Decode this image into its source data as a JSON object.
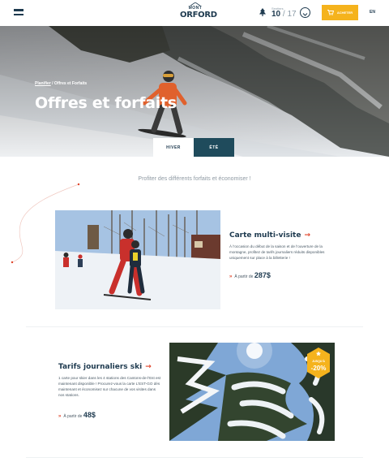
{
  "header": {
    "logo_top": "MONT",
    "logo_main": "ORFORD",
    "open_label": "Sentiers",
    "open_value": "10",
    "open_total": "/ 17",
    "buy_label": "ACHETER",
    "lang": "EN"
  },
  "hero": {
    "breadcrumb_parent": "Planifier",
    "breadcrumb_sep": " / ",
    "breadcrumb_current": "Offres et Forfaits",
    "title": "Offres et forfaits"
  },
  "tabs": [
    {
      "label": "HIVER",
      "active": true
    },
    {
      "label": "ÉTÉ",
      "active": false
    }
  ],
  "subtitle": "Profiter des différents forfaits et économiser !",
  "offers": [
    {
      "title": "Carte multi-visite",
      "arrow": "→",
      "description": "À l’occasion du début de la saison et de l’ouverture de la montagne, profitez de tarifs journaliers réduits disponibles uniquement sur place à la billetterie !",
      "price_prefix": "À partir de",
      "price": "287$"
    },
    {
      "title": "Tarifs journaliers ski",
      "arrow": "→",
      "description": "1 carte pour skier dans les 4 stations des Cantons-de-l’Est est maintenant disponible ! Procurez-vous la carte L’EST-GO dès maintenant et économisez sur chacune de vos visites dans nos stations.",
      "price_prefix": "À partir de",
      "price": "48$",
      "badge_label": "JUSQU'À",
      "badge_value": "-20%"
    }
  ],
  "icons": {
    "menu": "hamburger-icon",
    "tree": "pine-tree-icon",
    "chevron": "chevron-down-icon",
    "cart": "cart-icon",
    "badge_star": "star-icon"
  },
  "colors": {
    "navy": "#1e3a4f",
    "accent_yellow": "#f5b31d",
    "accent_red": "#e0452b",
    "tab_dark": "#1f4b5c"
  }
}
